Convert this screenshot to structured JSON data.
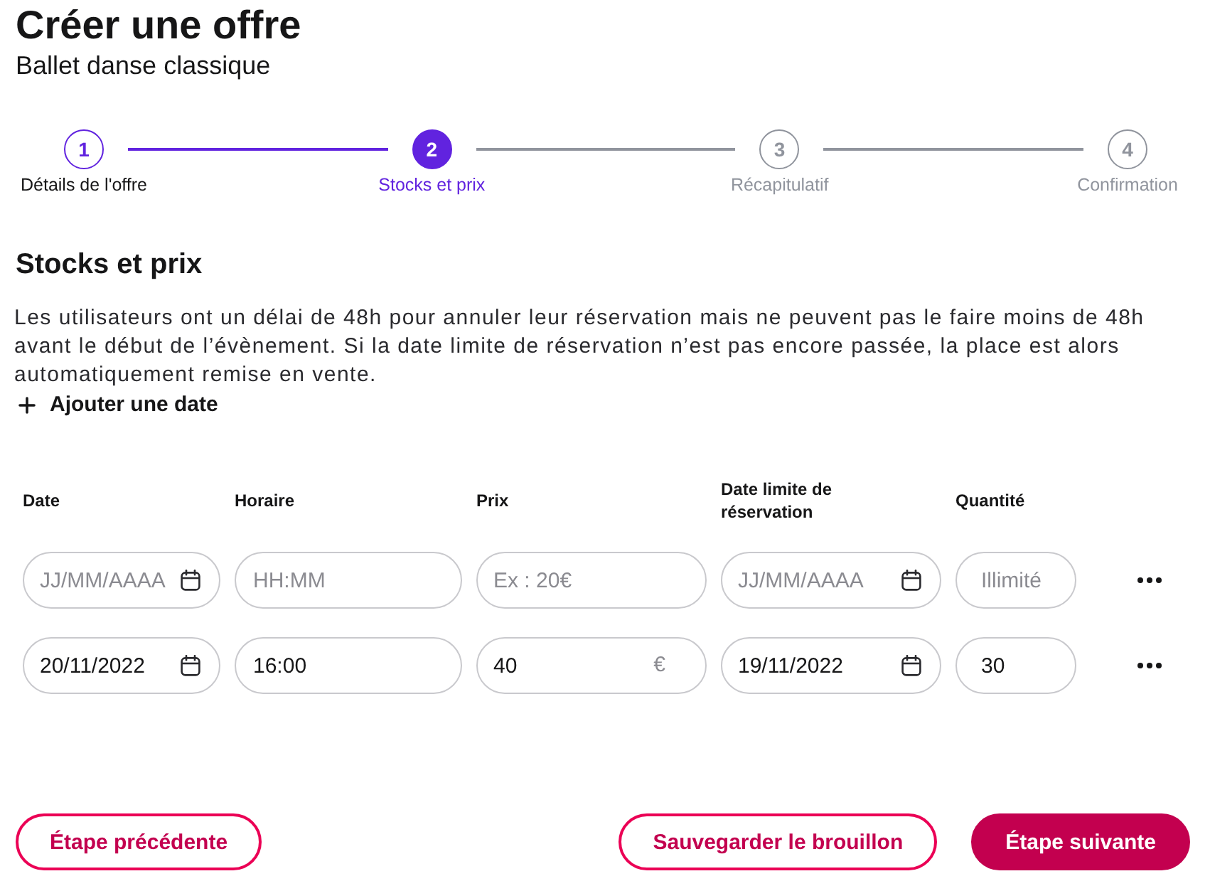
{
  "page": {
    "title": "Créer une offre",
    "subtitle": "Ballet danse classique"
  },
  "stepper": {
    "steps": [
      {
        "number": "1",
        "label": "Détails de l'offre",
        "completed": true,
        "selected": false
      },
      {
        "number": "2",
        "label": "Stocks et prix",
        "completed": false,
        "selected": true
      },
      {
        "number": "3",
        "label": "Récapitulatif",
        "completed": false,
        "selected": false
      },
      {
        "number": "4",
        "label": "Confirmation",
        "completed": false,
        "selected": false
      }
    ]
  },
  "section": {
    "heading": "Stocks et prix",
    "description": "Les utilisateurs ont un délai de 48h pour annuler leur réservation mais ne peuvent pas le faire moins de 48h avant le début de l’évènement. Si la date limite de réservation n’est pas encore passée, la place est alors automatiquement remise en vente.",
    "add_button": {
      "label": "Ajouter une date"
    }
  },
  "table": {
    "columns": [
      "Date",
      "Horaire",
      "Prix",
      "Date limite de réservation",
      "Quantité"
    ],
    "rows": [
      {
        "cells": [
          {
            "kind": "date",
            "placeholder": "JJ/MM/AAAA"
          },
          {
            "kind": "time",
            "placeholder": "HH:MM"
          },
          {
            "kind": "price",
            "placeholder": "Ex : 20€"
          },
          {
            "kind": "date",
            "placeholder": "JJ/MM/AAAA"
          },
          {
            "kind": "quantity",
            "placeholder": "Illimité"
          }
        ]
      },
      {
        "cells": [
          {
            "kind": "date",
            "value": "20/11/2022"
          },
          {
            "kind": "time",
            "value": "16:00"
          },
          {
            "kind": "price",
            "value": "40",
            "suffix": "€"
          },
          {
            "kind": "date",
            "value": "19/11/2022"
          },
          {
            "kind": "quantity",
            "value": "30"
          }
        ]
      }
    ]
  },
  "footer": {
    "buttons": [
      {
        "label": "Étape précédente",
        "kind": "outline"
      },
      {
        "label": "Sauvegarder le brouillon",
        "kind": "outline"
      },
      {
        "label": "Étape suivante",
        "kind": "primary"
      }
    ]
  }
}
